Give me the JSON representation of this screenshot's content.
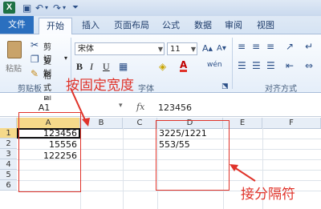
{
  "title_bar": {
    "logo": "X"
  },
  "tabs": [
    "文件",
    "开始",
    "插入",
    "页面布局",
    "公式",
    "数据",
    "审阅",
    "视图"
  ],
  "ribbon": {
    "paste_label": "粘贴",
    "cut_label": "剪切",
    "copy_label": "复制",
    "format_painter_label": "格式刷",
    "clipboard_group": "剪贴板",
    "font_name": "宋体",
    "font_size": "11",
    "bold": "B",
    "italic": "I",
    "underline": "U",
    "font_group": "字体",
    "alignment_group": "对齐方式",
    "font_color_glyph": "A",
    "phonetic_glyph": "wén"
  },
  "formula_bar": {
    "name_box": "A1",
    "fx": "fx",
    "value": "123456"
  },
  "columns": [
    "A",
    "B",
    "C",
    "D",
    "E",
    "F"
  ],
  "rows": [
    "1",
    "2",
    "3",
    "4",
    "5",
    "6"
  ],
  "cells": {
    "a1": "123456",
    "a2": "15556",
    "a3": "122256",
    "d1": "3225/1221",
    "d2": "553/55"
  },
  "annotations": {
    "fixed_width": "按固定宽度",
    "delimiter": "接分隔符"
  },
  "colors": {
    "annotation": "#e0332a",
    "file_tab": "#2a6fbf"
  }
}
